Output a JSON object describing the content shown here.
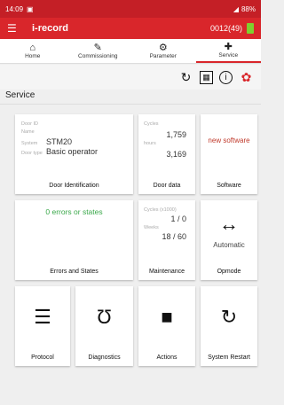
{
  "status": {
    "time": "14:09",
    "right": "88%"
  },
  "appbar": {
    "title": "i-record",
    "device": "0012(49)"
  },
  "tabs": [
    {
      "label": "Home",
      "icon": "⌂"
    },
    {
      "label": "Commissioning",
      "icon": "✎"
    },
    {
      "label": "Parameter",
      "icon": "⚙"
    },
    {
      "label": "Service",
      "icon": "🔧"
    }
  ],
  "section_title": "Service",
  "cards": {
    "door_identification": {
      "title": "Door Identification",
      "door_id_label": "Door ID",
      "name_label": "Name",
      "system_label": "System",
      "system_value": "STM20",
      "door_type_label": "Door type",
      "door_type_value": "Basic operator"
    },
    "door_data": {
      "title": "Door data",
      "cycles_label": "Cycles",
      "cycles_value": "1,759",
      "hours_label": "hours",
      "hours_value": "3,169"
    },
    "software": {
      "title": "Software",
      "status": "new software"
    },
    "errors": {
      "title": "Errors and States",
      "status": "0 errors or states"
    },
    "maintenance": {
      "title": "Maintenance",
      "cycles_label": "Cycles (x1000)",
      "cycles_value": "1 / 0",
      "weeks_label": "Weeks",
      "weeks_value": "18 / 60"
    },
    "opmode": {
      "title": "Opmode",
      "value": "Automatic"
    },
    "protocol": {
      "title": "Protocol"
    },
    "diagnostics": {
      "title": "Diagnostics"
    },
    "actions": {
      "title": "Actions"
    },
    "system_restart": {
      "title": "System Restart"
    }
  },
  "colors": {
    "brand": "#d9262b",
    "green": "#3aa84a",
    "red_text": "#c0392b"
  }
}
